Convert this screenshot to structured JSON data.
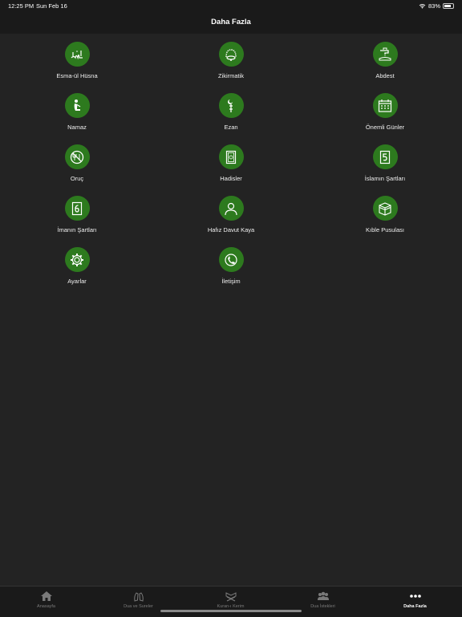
{
  "status_bar": {
    "time": "12:25 PM",
    "date": "Sun Feb 16",
    "battery": "83%",
    "battery_level": 0.83
  },
  "nav": {
    "title": "Daha Fazla"
  },
  "accent_color": "#2d7a1e",
  "grid_items": [
    {
      "label": "Esma-ül Hüsna",
      "icon": "calligraphy-icon"
    },
    {
      "label": "Zikirmatik",
      "icon": "prayer-beads-icon"
    },
    {
      "label": "Abdest",
      "icon": "water-tap-icon"
    },
    {
      "label": "Namaz",
      "icon": "praying-person-icon"
    },
    {
      "label": "Ezan",
      "icon": "minaret-icon"
    },
    {
      "label": "Önemli Günler",
      "icon": "calendar-icon"
    },
    {
      "label": "Oruç",
      "icon": "no-eating-icon"
    },
    {
      "label": "Hadisler",
      "icon": "book-icon"
    },
    {
      "label": "İslamın Şartları",
      "icon": "number-five-icon"
    },
    {
      "label": "İmanın Şartları",
      "icon": "number-six-icon"
    },
    {
      "label": "Hafız Davut Kaya",
      "icon": "person-icon"
    },
    {
      "label": "Kıble Pusulası",
      "icon": "kaaba-icon"
    },
    {
      "label": "Ayarlar",
      "icon": "gear-icon"
    },
    {
      "label": "İletişim",
      "icon": "contact-icon"
    }
  ],
  "tabs": [
    {
      "label": "Anasayfa",
      "icon": "home-icon"
    },
    {
      "label": "Dua ve Sureler",
      "icon": "hands-icon"
    },
    {
      "label": "Kuran-ı Kerim",
      "icon": "quran-stand-icon"
    },
    {
      "label": "Dua İstekleri",
      "icon": "group-icon"
    },
    {
      "label": "Daha Fazla",
      "icon": "more-icon"
    }
  ],
  "active_tab": "Daha Fazla"
}
